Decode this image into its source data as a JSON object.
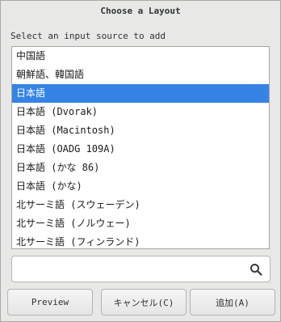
{
  "window": {
    "title": "Choose a Layout"
  },
  "prompt": "Select an input source to add",
  "list": {
    "selected_index": 2,
    "items": [
      {
        "label": "中国語",
        "mono": false
      },
      {
        "label": "朝鮮語、韓国語",
        "mono": false
      },
      {
        "label": "日本語",
        "mono": false
      },
      {
        "label": "日本語 (Dvorak)",
        "mono": true
      },
      {
        "label": "日本語 (Macintosh)",
        "mono": true
      },
      {
        "label": "日本語 (OADG 109A)",
        "mono": true
      },
      {
        "label": "日本語 (かな 86)",
        "mono": true
      },
      {
        "label": "日本語 (かな)",
        "mono": true
      },
      {
        "label": "北サーミ語 (スウェーデン)",
        "mono": true
      },
      {
        "label": "北サーミ語 (ノルウェー)",
        "mono": true
      },
      {
        "label": "北サーミ語 (フィンランド)",
        "mono": true
      }
    ]
  },
  "search": {
    "value": "",
    "placeholder": "",
    "icon": "search-icon"
  },
  "buttons": {
    "preview": "Preview",
    "cancel": "キャンセル(C)",
    "add": "追加(A)"
  },
  "colors": {
    "selection": "#3584e4",
    "background": "#e8e8e7"
  }
}
